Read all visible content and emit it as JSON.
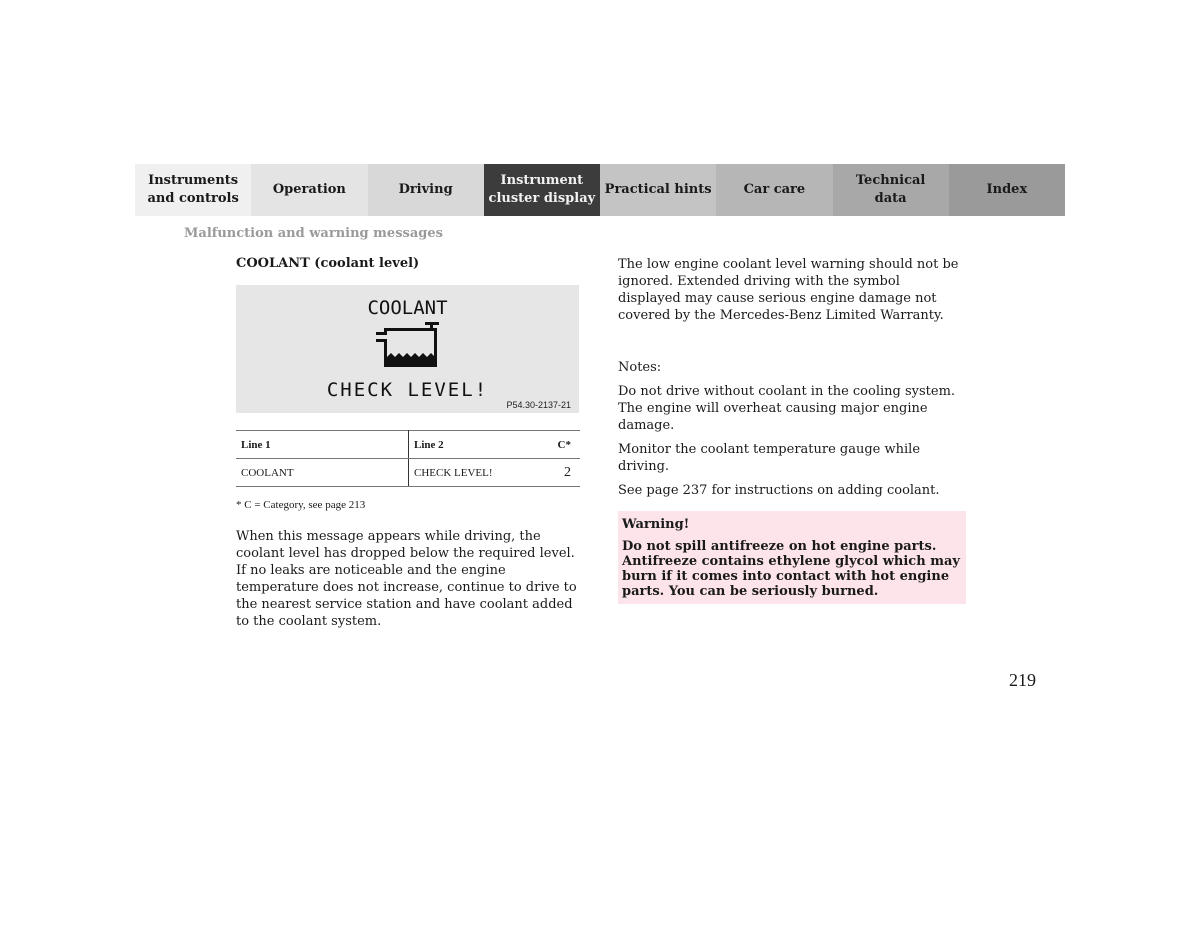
{
  "nav": {
    "tabs": [
      {
        "label": "Instruments and controls",
        "line1": "Instruments",
        "line2": "and controls",
        "bg": "#f0f0f0",
        "active": false
      },
      {
        "label": "Operation",
        "line1": "Operation",
        "line2": "",
        "bg": "#e4e4e4",
        "active": false
      },
      {
        "label": "Driving",
        "line1": "Driving",
        "line2": "",
        "bg": "#d8d8d8",
        "active": false
      },
      {
        "label": "Instrument cluster display",
        "line1": "Instrument",
        "line2": "cluster display",
        "bg": "#3c3c3c",
        "active": true
      },
      {
        "label": "Practical hints",
        "line1": "Practical hints",
        "line2": "",
        "bg": "#c4c4c4",
        "active": false
      },
      {
        "label": "Car care",
        "line1": "Car care",
        "line2": "",
        "bg": "#b6b6b6",
        "active": false
      },
      {
        "label": "Technical data",
        "line1": "Technical",
        "line2": "data",
        "bg": "#a8a8a8",
        "active": false
      },
      {
        "label": "Index",
        "line1": "Index",
        "line2": "",
        "bg": "#9a9a9a",
        "active": false
      }
    ]
  },
  "section_title": "Malfunction and warning messages",
  "left": {
    "heading": "COOLANT (coolant level)",
    "display": {
      "line1": "COOLANT",
      "line2": "CHECK LEVEL!",
      "icon": "coolant-reservoir-icon",
      "figure_code": "P54.30-2137-21"
    },
    "table": {
      "headers": [
        "Line 1",
        "Line 2",
        "C*"
      ],
      "rows": [
        [
          "COOLANT",
          "CHECK LEVEL!",
          "2"
        ]
      ]
    },
    "footnote": "* C = Category, see page 213",
    "body": "When this message appears while driving, the coolant level has dropped below the required level. If no leaks are noticeable and the engine temperature does not increase, continue to drive to the nearest service station and have coolant added to the coolant system."
  },
  "right": {
    "para1": "The low engine coolant level warning should not be ignored. Extended driving with the symbol displayed may cause serious engine damage not covered by the Mercedes-Benz Limited Warranty.",
    "notes_label": "Notes:",
    "notes": [
      "Do not drive without coolant in the cooling system. The engine will overheat causing major engine damage.",
      "Monitor the coolant temperature gauge while driving.",
      "See page 237 for instructions on adding coolant."
    ],
    "warning": {
      "title": "Warning!",
      "text": "Do not spill antifreeze on hot engine parts. Antifreeze contains ethylene glycol which may burn if it comes into contact with hot engine parts. You can be seriously burned.",
      "bg": "#fce4ea"
    }
  },
  "page_number": "219"
}
